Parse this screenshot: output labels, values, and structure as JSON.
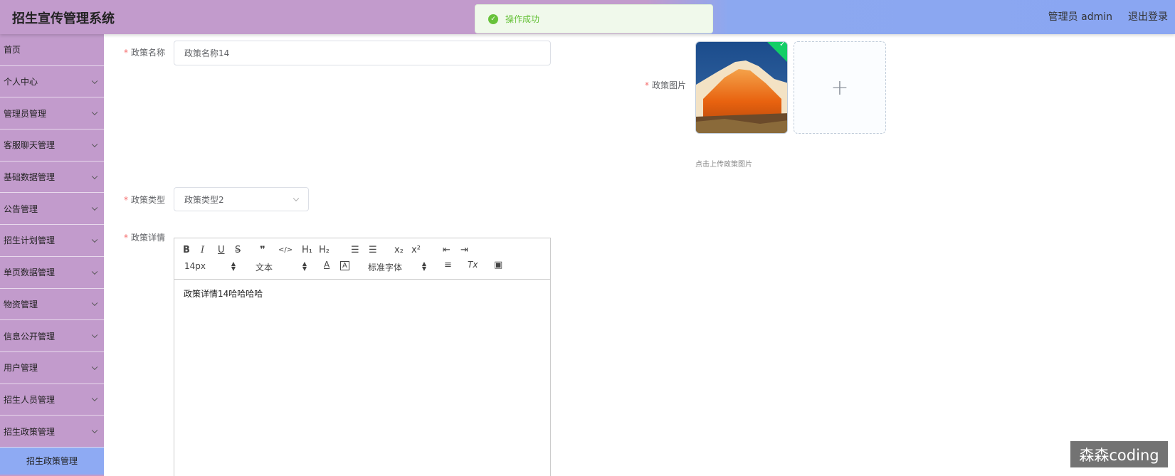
{
  "header": {
    "title": "招生宣传管理系统",
    "user": "管理员 admin",
    "logout": "退出登录"
  },
  "toast": {
    "message": "操作成功",
    "type": "success"
  },
  "sidebar": {
    "items": [
      {
        "label": "首页",
        "expandable": false
      },
      {
        "label": "个人中心",
        "expandable": true
      },
      {
        "label": "管理员管理",
        "expandable": true
      },
      {
        "label": "客服聊天管理",
        "expandable": true
      },
      {
        "label": "基础数据管理",
        "expandable": true
      },
      {
        "label": "公告管理",
        "expandable": true
      },
      {
        "label": "招生计划管理",
        "expandable": true
      },
      {
        "label": "单页数据管理",
        "expandable": true
      },
      {
        "label": "物资管理",
        "expandable": true
      },
      {
        "label": "信息公开管理",
        "expandable": true
      },
      {
        "label": "用户管理",
        "expandable": true
      },
      {
        "label": "招生人员管理",
        "expandable": true
      },
      {
        "label": "招生政策管理",
        "expandable": true
      }
    ],
    "active_sub": "招生政策管理"
  },
  "form": {
    "required_mark": "*",
    "name_label": "政策名称",
    "name_value": "政策名称14",
    "image_label": "政策图片",
    "image_tip": "点击上传政策图片",
    "add_icon": "+",
    "type_label": "政策类型",
    "type_value": "政策类型2",
    "detail_label": "政策详情",
    "detail_value": "政策详情14哈哈哈哈"
  },
  "editor_toolbar": {
    "bold": "B",
    "italic": "I",
    "underline": "U",
    "strike": "S",
    "quote": "❞",
    "code": "</>",
    "h1": "H₁",
    "h2": "H₂",
    "ordered_list": "☰",
    "bullet_list": "☰",
    "subscript": "x₂",
    "superscript": "x²",
    "outdent": "⇤",
    "indent": "⇥",
    "size": "14px",
    "paragraph": "文本",
    "color": "A",
    "background": "A",
    "font": "标准字体",
    "align": "≡",
    "clean": "Tx",
    "image": "▣"
  },
  "watermark": "森森coding",
  "colors": {
    "sidebar": "#c29bcc",
    "header_right": "#8aa6f2",
    "active_submenu": "#8eaaf3",
    "success": "#67c23a",
    "required": "#f56c6c"
  }
}
